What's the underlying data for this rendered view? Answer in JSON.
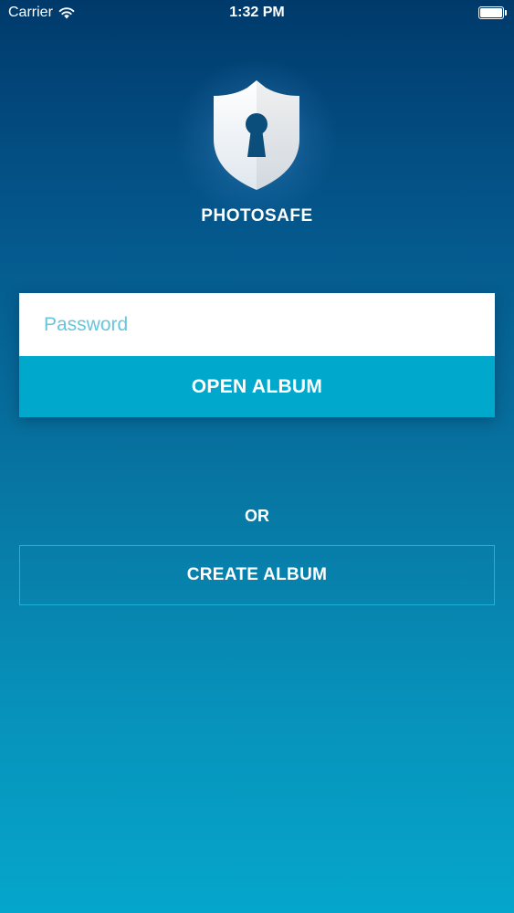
{
  "status_bar": {
    "carrier": "Carrier",
    "time": "1:32 PM",
    "wifi_icon": "wifi-icon",
    "battery_icon": "battery-full-icon"
  },
  "app": {
    "name": "PHOTOSAFE",
    "logo_icon": "shield-keyhole-icon"
  },
  "login": {
    "password_placeholder": "Password",
    "password_value": "",
    "open_label": "OPEN ALBUM"
  },
  "divider": {
    "or_label": "OR"
  },
  "create": {
    "label": "CREATE ALBUM"
  },
  "colors": {
    "gradient_top": "#003a6b",
    "gradient_bottom": "#05a6cb",
    "accent": "#00a9cc",
    "placeholder": "#65c6dc",
    "create_border": "#1fb2d9"
  }
}
